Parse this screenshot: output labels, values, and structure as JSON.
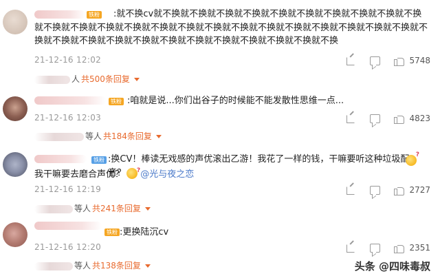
{
  "comments": [
    {
      "badge": "铁粉",
      "text": ":就不换cv就不换就不换就不换就不换就不换就不换就不换就不换就不换就不换就不换就不换就不换就不换就不换就不换就不换就不换就不换就不换就不换就不换就不换就不换就不换就不换就不换就不换就不换就不换就不换就不换就不换就不换就不换就不换",
      "time": "21-12-16 12:02",
      "likes": "5748",
      "reply_suffix": "人",
      "reply_count": "共500条回复"
    },
    {
      "badge": "铁粉",
      "text": ":咱就是说...你们出谷子的时候能不能发散性思维一点...",
      "time": "21-12-16 12:03",
      "likes": "4823",
      "reply_suffix": "等人",
      "reply_count": "共184条回复"
    },
    {
      "badge": "铁粉",
      "text_line1": ":换CV！棒读无戏感的声优滚出乙游！我花了一样的钱，干嘛要听这种垃圾配音？",
      "text_line2": "我干嘛要去磨合声优？",
      "mention": "@光与夜之恋",
      "time": "21-12-16 12:19",
      "likes": "2727",
      "reply_suffix": "等人",
      "reply_count": "共241条回复"
    },
    {
      "badge": "铁粉",
      "text": ":更换陆沉cv",
      "time": "21-12-16 12:20",
      "likes": "2351",
      "reply_suffix": "等人",
      "reply_count": "共138条回复"
    }
  ],
  "watermark": "头条 @四味毒叔",
  "icons": {
    "share": "share-icon",
    "comment": "comment-icon",
    "like": "like-icon",
    "expand": "caret-down-icon"
  },
  "colors": {
    "badge_gold": "#f5a623",
    "badge_blue": "#57a0e6",
    "reply_orange": "#e86a2e",
    "mention_blue": "#4a79c9"
  }
}
